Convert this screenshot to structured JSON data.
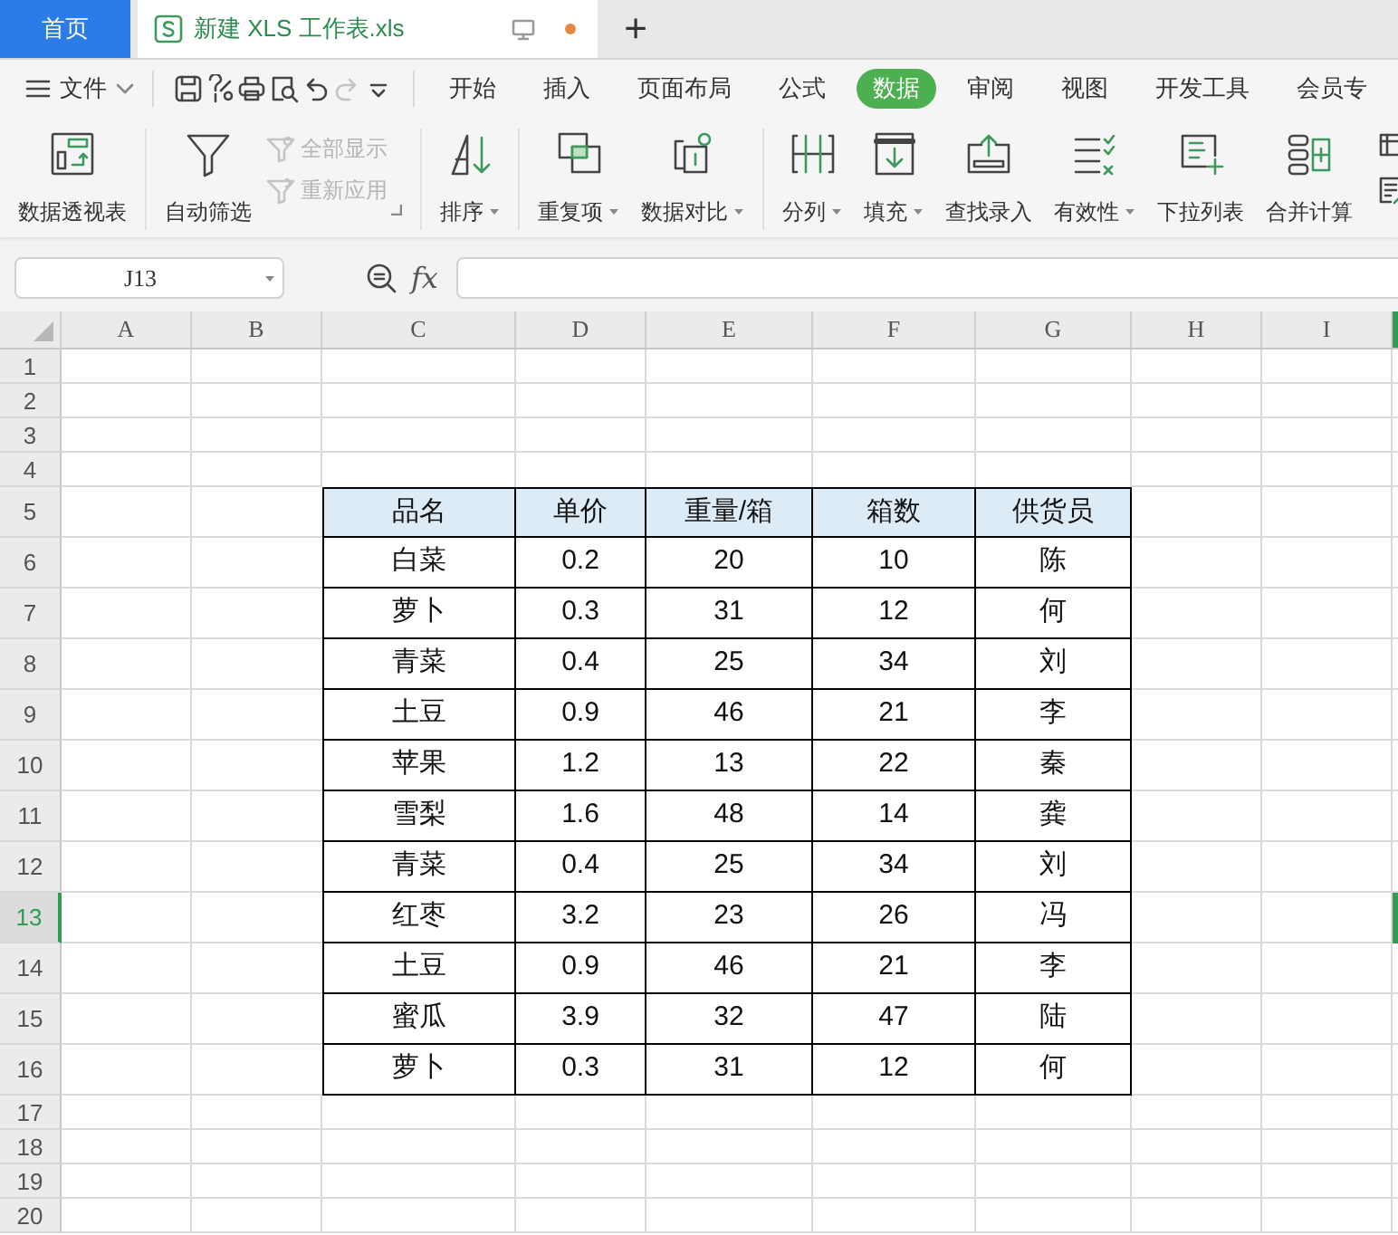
{
  "tabs": [
    {
      "kind": "home",
      "label": "首页",
      "selected": false
    },
    {
      "kind": "doc",
      "label": "新建 XLS 工作表.xls",
      "selected": true,
      "modified": true
    }
  ],
  "new_tab": "+",
  "menu": {
    "file": "文件",
    "quick_access": [
      {
        "kind": "save",
        "disabled": false
      },
      {
        "kind": "format-painter",
        "disabled": false
      },
      {
        "kind": "print",
        "disabled": false
      },
      {
        "kind": "preview",
        "disabled": false
      },
      {
        "kind": "undo",
        "disabled": false
      },
      {
        "kind": "redo",
        "disabled": true
      },
      {
        "kind": "more",
        "disabled": false
      }
    ],
    "tabs": [
      {
        "label": "开始",
        "selected": false
      },
      {
        "label": "插入",
        "selected": false
      },
      {
        "label": "页面布局",
        "selected": false
      },
      {
        "label": "公式",
        "selected": false
      },
      {
        "label": "数据",
        "selected": true
      },
      {
        "label": "审阅",
        "selected": false
      },
      {
        "label": "视图",
        "selected": false
      },
      {
        "label": "开发工具",
        "selected": false
      },
      {
        "label": "会员专",
        "selected": false
      }
    ]
  },
  "ribbon": {
    "groups": [
      [
        {
          "kind": "large",
          "label": "数据透视表",
          "dropdown": false
        }
      ],
      [
        {
          "kind": "large",
          "label": "自动筛选",
          "dropdown": false
        },
        {
          "kind": "stack",
          "launcher": true,
          "items": [
            {
              "label": "全部显示",
              "disabled": true
            },
            {
              "label": "重新应用",
              "disabled": true
            }
          ]
        }
      ],
      [
        {
          "kind": "large",
          "label": "排序",
          "dropdown": true
        }
      ],
      [
        {
          "kind": "large",
          "label": "重复项",
          "dropdown": true
        },
        {
          "kind": "large",
          "label": "数据对比",
          "dropdown": true
        }
      ],
      [
        {
          "kind": "large",
          "label": "分列",
          "dropdown": true
        },
        {
          "kind": "large",
          "label": "填充",
          "dropdown": true
        },
        {
          "kind": "large",
          "label": "查找录入",
          "dropdown": false
        },
        {
          "kind": "large",
          "label": "有效性",
          "dropdown": true
        },
        {
          "kind": "large",
          "label": "下拉列表",
          "dropdown": false
        },
        {
          "kind": "large",
          "label": "合并计算",
          "dropdown": false
        }
      ]
    ]
  },
  "formula_bar": {
    "name_box": "J13",
    "fx": "fx"
  },
  "sheet": {
    "columns": [
      "A",
      "B",
      "C",
      "D",
      "E",
      "F",
      "G",
      "H",
      "I"
    ],
    "rows": [
      {
        "label": "1",
        "kind": "blank",
        "selected": false
      },
      {
        "label": "2",
        "kind": "blank",
        "selected": false
      },
      {
        "label": "3",
        "kind": "blank",
        "selected": false
      },
      {
        "label": "4",
        "kind": "blank",
        "selected": false
      },
      {
        "label": "5",
        "kind": "header",
        "selected": false,
        "cells": [
          "品名",
          "单价",
          "重量/箱",
          "箱数",
          "供货员"
        ]
      },
      {
        "label": "6",
        "kind": "data",
        "selected": false,
        "cells": [
          "白菜",
          "0.2",
          "20",
          "10",
          "陈"
        ]
      },
      {
        "label": "7",
        "kind": "data",
        "selected": false,
        "cells": [
          "萝卜",
          "0.3",
          "31",
          "12",
          "何"
        ]
      },
      {
        "label": "8",
        "kind": "data",
        "selected": false,
        "cells": [
          "青菜",
          "0.4",
          "25",
          "34",
          "刘"
        ]
      },
      {
        "label": "9",
        "kind": "data",
        "selected": false,
        "cells": [
          "土豆",
          "0.9",
          "46",
          "21",
          "李"
        ]
      },
      {
        "label": "10",
        "kind": "data",
        "selected": false,
        "cells": [
          "苹果",
          "1.2",
          "13",
          "22",
          "秦"
        ]
      },
      {
        "label": "11",
        "kind": "data",
        "selected": false,
        "cells": [
          "雪梨",
          "1.6",
          "48",
          "14",
          "龚"
        ]
      },
      {
        "label": "12",
        "kind": "data",
        "selected": false,
        "cells": [
          "青菜",
          "0.4",
          "25",
          "34",
          "刘"
        ]
      },
      {
        "label": "13",
        "kind": "data",
        "selected": true,
        "cells": [
          "红枣",
          "3.2",
          "23",
          "26",
          "冯"
        ]
      },
      {
        "label": "14",
        "kind": "data",
        "selected": false,
        "cells": [
          "土豆",
          "0.9",
          "46",
          "21",
          "李"
        ]
      },
      {
        "label": "15",
        "kind": "data",
        "selected": false,
        "cells": [
          "蜜瓜",
          "3.9",
          "32",
          "47",
          "陆"
        ]
      },
      {
        "label": "16",
        "kind": "data",
        "selected": false,
        "cells": [
          "萝卜",
          "0.3",
          "31",
          "12",
          "何"
        ]
      },
      {
        "label": "17",
        "kind": "blank",
        "selected": false
      },
      {
        "label": "18",
        "kind": "blank",
        "selected": false
      },
      {
        "label": "19",
        "kind": "blank",
        "selected": false
      },
      {
        "label": "20",
        "kind": "blank",
        "selected": false
      }
    ]
  }
}
